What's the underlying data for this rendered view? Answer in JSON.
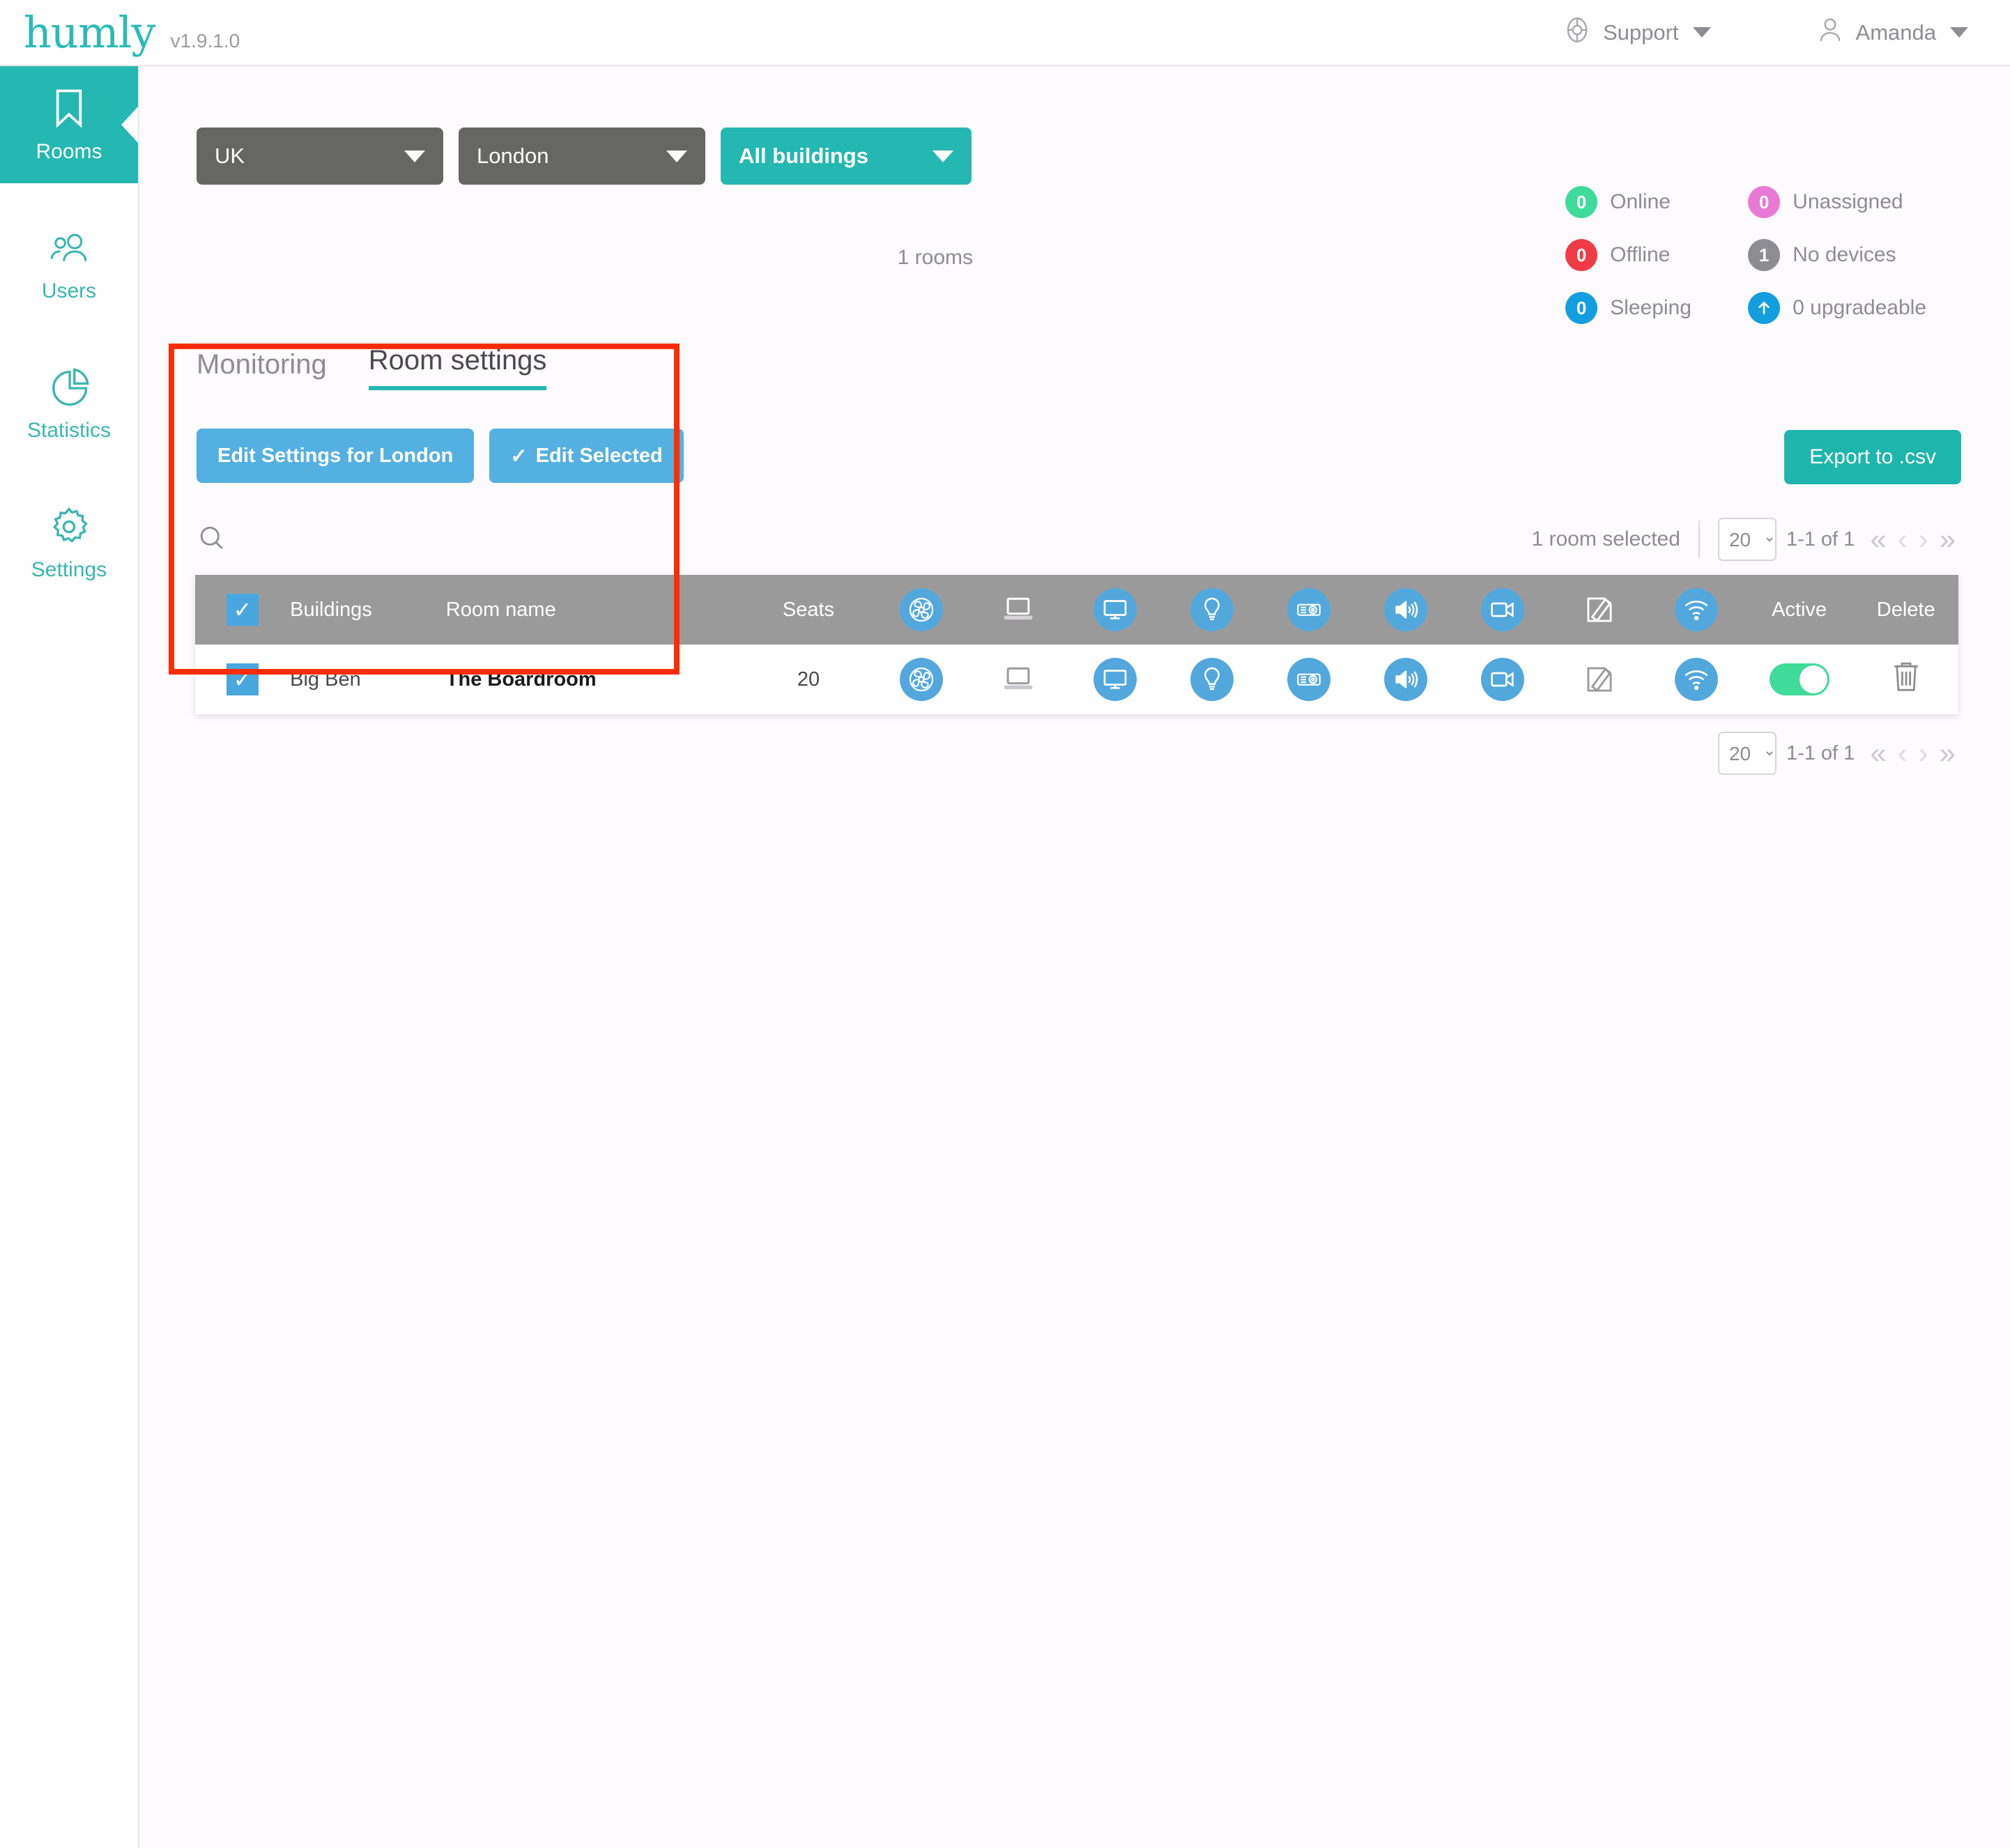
{
  "header": {
    "logo": "humly",
    "version": "v1.9.1.0",
    "support_label": "Support",
    "user_label": "Amanda",
    "support_icon": "lifebuoy-icon",
    "user_icon": "person-icon"
  },
  "sidebar": {
    "items": [
      {
        "label": "Rooms",
        "icon": "bookmark-icon",
        "active": true
      },
      {
        "label": "Users",
        "icon": "people-icon",
        "active": false
      },
      {
        "label": "Statistics",
        "icon": "pie-chart-icon",
        "active": false
      },
      {
        "label": "Settings",
        "icon": "gear-icon",
        "active": false
      }
    ]
  },
  "filters": {
    "country": "UK",
    "city": "London",
    "buildings": "All buildings",
    "rooms_count": "1 rooms"
  },
  "status": [
    {
      "count": "0",
      "label": "Online",
      "color": "#3edb9b"
    },
    {
      "count": "0",
      "label": "Unassigned",
      "color": "#e879d4"
    },
    {
      "count": "0",
      "label": "Offline",
      "color": "#ef3b45"
    },
    {
      "count": "1",
      "label": "No devices",
      "color": "#8d8c92"
    },
    {
      "count": "0",
      "label": "Sleeping",
      "color": "#139ee0"
    },
    {
      "count": "",
      "label": "0 upgradeable",
      "color": "#139ee0",
      "icon": "arrow-up-icon"
    }
  ],
  "tabs": [
    {
      "label": "Monitoring",
      "active": false
    },
    {
      "label": "Room settings",
      "active": true
    }
  ],
  "toolbar": {
    "edit_settings_label": "Edit Settings for London",
    "edit_selected_label": "Edit Selected",
    "edit_selected_check": "✓",
    "export_label": "Export to .csv"
  },
  "search": {
    "value": "",
    "placeholder": "",
    "icon": "search-icon"
  },
  "pagination": {
    "selected_text": "1 room selected",
    "page_size": "20",
    "page_size_options": [
      "20"
    ],
    "range": "1-1 of 1",
    "first": "«",
    "prev": "‹",
    "next": "›",
    "last": "»"
  },
  "table": {
    "columns": [
      {
        "key": "check",
        "label": "",
        "type": "checkbox",
        "icon": "checkbox-icon"
      },
      {
        "key": "buildings",
        "label": "Buildings",
        "type": "text"
      },
      {
        "key": "room_name",
        "label": "Room name",
        "type": "text"
      },
      {
        "key": "seats",
        "label": "Seats",
        "type": "text"
      },
      {
        "key": "air",
        "label": "",
        "type": "icon",
        "icon": "fan-icon"
      },
      {
        "key": "laptop",
        "label": "",
        "type": "icon",
        "icon": "laptop-icon"
      },
      {
        "key": "display",
        "label": "",
        "type": "icon",
        "icon": "monitor-icon"
      },
      {
        "key": "light",
        "label": "",
        "type": "icon",
        "icon": "lightbulb-icon"
      },
      {
        "key": "projector",
        "label": "",
        "type": "icon",
        "icon": "projector-icon"
      },
      {
        "key": "audio",
        "label": "",
        "type": "icon",
        "icon": "speaker-icon"
      },
      {
        "key": "video",
        "label": "",
        "type": "icon",
        "icon": "video-camera-icon"
      },
      {
        "key": "whiteboard",
        "label": "",
        "type": "icon",
        "icon": "whiteboard-pen-icon"
      },
      {
        "key": "wifi",
        "label": "",
        "type": "icon",
        "icon": "wifi-icon"
      },
      {
        "key": "active",
        "label": "Active",
        "type": "toggle"
      },
      {
        "key": "delete",
        "label": "Delete",
        "type": "trash",
        "icon": "trash-icon"
      }
    ],
    "rows": [
      {
        "checked": true,
        "buildings": "Big Ben",
        "room_name": "The Boardroom",
        "seats": "20",
        "active": true
      }
    ]
  },
  "annotation": {
    "color": "#fc2d02"
  }
}
